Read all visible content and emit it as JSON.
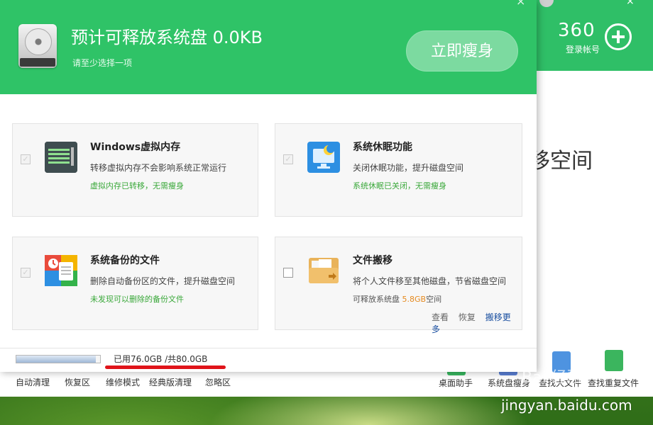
{
  "background_app": {
    "logo_text": "360",
    "login_label": "登录帐号",
    "heading_partial": "移空间",
    "bottom_tools_left": [
      "自动清理",
      "恢复区",
      "维修模式",
      "经典版清理",
      "忽略区"
    ],
    "bottom_tools_right": [
      "桌面助手",
      "系统盘瘦身",
      "查找大文件",
      "查找重复文件"
    ]
  },
  "dialog": {
    "title": "预计可释放系统盘 0.0KB",
    "subtitle": "请至少选择一项",
    "primary_button": "立即瘦身",
    "cards": [
      {
        "title": "Windows虚拟内存",
        "desc": "转移虚拟内存不会影响系统正常运行",
        "status": "虚拟内存已转移，无需瘦身",
        "checked": true,
        "enabled": false,
        "icon": "memory-icon"
      },
      {
        "title": "系统休眠功能",
        "desc": "关闭休眠功能，提升磁盘空间",
        "status": "系统休眠已关闭，无需瘦身",
        "checked": true,
        "enabled": false,
        "icon": "hibernate-icon"
      },
      {
        "title": "系统备份的文件",
        "desc": "删除自动备份区的文件，提升磁盘空间",
        "status": "未发现可以删除的备份文件",
        "checked": true,
        "enabled": false,
        "icon": "backup-files-icon"
      },
      {
        "title": "文件搬移",
        "desc": "将个人文件移至其他磁盘，节省磁盘空间",
        "status_prefix": "可释放系统盘 ",
        "status_value": "5.8GB",
        "status_suffix": "空间",
        "checked": false,
        "enabled": true,
        "icon": "folder-move-icon",
        "actions": [
          "查看",
          "恢复",
          "搬移更多"
        ]
      }
    ],
    "footer": {
      "usage_text": "已用76.0GB /共80.0GB",
      "used_fraction": 0.95
    }
  },
  "watermark": {
    "logo_text": "Bai 经验",
    "url": "jingyan.baidu.com"
  },
  "colors": {
    "brand_green": "#2fc367",
    "status_green": "#3aa83a",
    "highlight_orange": "#e58a1f",
    "link_blue": "#1a4fa0",
    "annotation_red": "#e0141a"
  }
}
